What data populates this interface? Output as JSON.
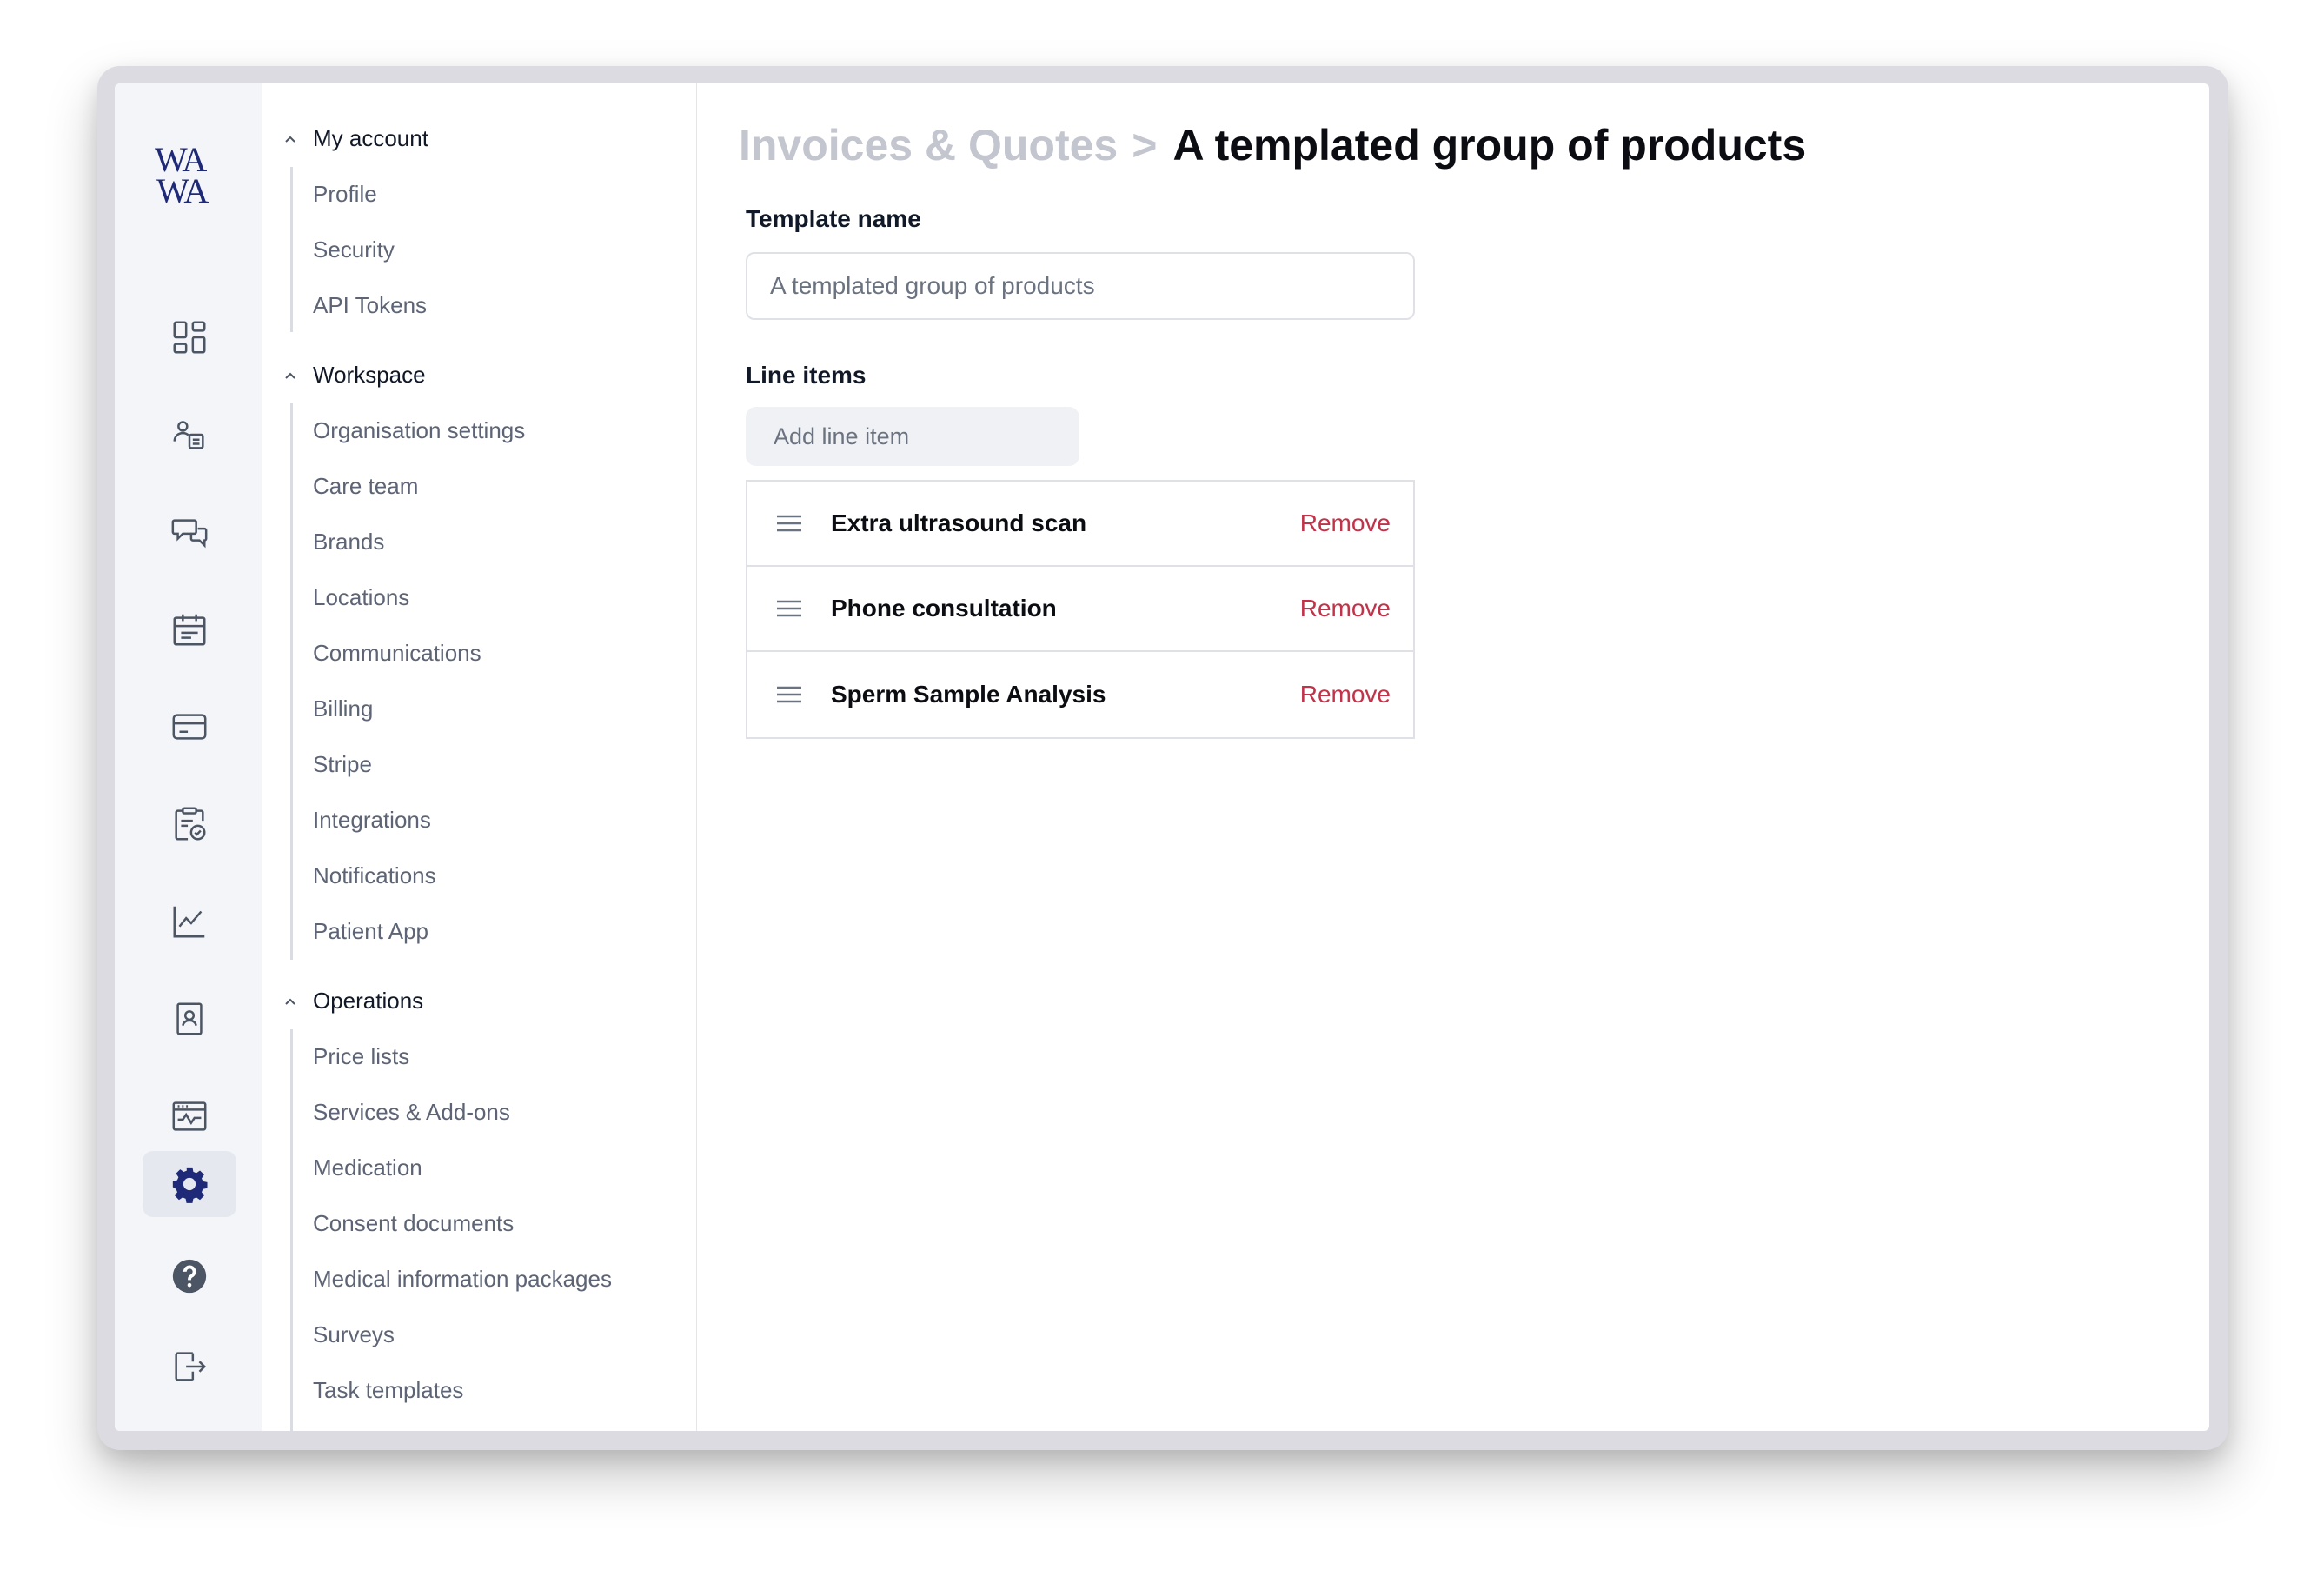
{
  "brand": {
    "logo_line1": "WA",
    "logo_line2": "WA"
  },
  "rail": {
    "icons": [
      "dashboard-icon",
      "patient-record-icon",
      "messages-icon",
      "calendar-icon",
      "payment-card-icon",
      "clipboard-check-icon",
      "analytics-icon",
      "contact-book-icon",
      "monitoring-icon",
      "settings-icon",
      "help-icon",
      "logout-icon"
    ],
    "active": "settings-icon",
    "accent_color": "#1e2a78"
  },
  "nav": {
    "sections": [
      {
        "title": "My account",
        "items": [
          "Profile",
          "Security",
          "API Tokens"
        ]
      },
      {
        "title": "Workspace",
        "items": [
          "Organisation settings",
          "Care team",
          "Brands",
          "Locations",
          "Communications",
          "Billing",
          "Stripe",
          "Integrations",
          "Notifications",
          "Patient App"
        ]
      },
      {
        "title": "Operations",
        "items": [
          "Price lists",
          "Services & Add-ons",
          "Medication",
          "Consent documents",
          "Medical information packages",
          "Surveys",
          "Task templates"
        ]
      }
    ]
  },
  "main": {
    "breadcrumb": {
      "parent": "Invoices & Quotes",
      "separator": ">",
      "current": "A templated group of products"
    },
    "template_name_label": "Template name",
    "template_name_value": "A templated group of products",
    "line_items_label": "Line items",
    "add_line_item_placeholder": "Add line item",
    "line_items": [
      {
        "name": "Extra ultrasound scan",
        "action": "Remove"
      },
      {
        "name": "Phone consultation",
        "action": "Remove"
      },
      {
        "name": "Sperm Sample Analysis",
        "action": "Remove"
      }
    ],
    "remove_color": "#c2334a"
  }
}
